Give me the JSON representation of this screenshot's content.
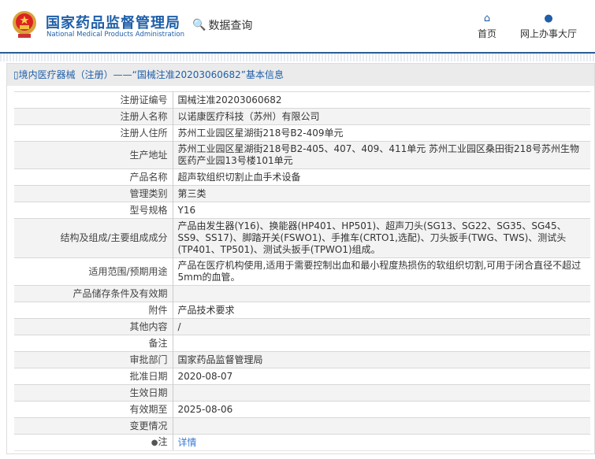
{
  "header": {
    "brand_cn": "国家药品监督管理局",
    "brand_en": "National Medical Products Administration",
    "query_label": "数据查询",
    "nav": [
      {
        "label": "首页",
        "icon": "home-icon"
      },
      {
        "label": "网上办事大厅",
        "icon": "user-icon"
      }
    ]
  },
  "breadcrumb": "境内医疗器械（注册）——“国械注准20203060682”基本信息",
  "rows": [
    {
      "label": "注册证编号",
      "value": "国械注准20203060682"
    },
    {
      "label": "注册人名称",
      "value": "以诺康医疗科技（苏州）有限公司"
    },
    {
      "label": "注册人住所",
      "value": "苏州工业园区星湖街218号B2-409单元"
    },
    {
      "label": "生产地址",
      "value": "苏州工业园区星湖街218号B2-405、407、409、411单元 苏州工业园区桑田街218号苏州生物医药产业园13号楼101单元"
    },
    {
      "label": "产品名称",
      "value": "超声软组织切割止血手术设备"
    },
    {
      "label": "管理类别",
      "value": "第三类"
    },
    {
      "label": "型号规格",
      "value": "Y16"
    },
    {
      "label": "结构及组成/主要组成成分",
      "value": "产品由发生器(Y16)、换能器(HP401、HP501)、超声刀头(SG13、SG22、SG35、SG45、SS9、SS17)、脚踏开关(FSWO1)、手推车(CRTO1,选配)、刀头扳手(TWG、TWS)、测试头(TP401、TP501)、测试头扳手(TPWO1)组成。"
    },
    {
      "label": "适用范围/预期用途",
      "value": "产品在医疗机构使用,适用于需要控制出血和最小程度热损伤的软组织切割,可用于闭合直径不超过5mm的血管。"
    },
    {
      "label": "产品储存条件及有效期",
      "value": ""
    },
    {
      "label": "附件",
      "value": "产品技术要求"
    },
    {
      "label": "其他内容",
      "value": "/"
    },
    {
      "label": "备注",
      "value": ""
    },
    {
      "label": "审批部门",
      "value": "国家药品监督管理局"
    },
    {
      "label": "批准日期",
      "value": "2020-08-07"
    },
    {
      "label": "生效日期",
      "value": ""
    },
    {
      "label": "有效期至",
      "value": "2025-08-06"
    },
    {
      "label": "变更情况",
      "value": ""
    },
    {
      "label": "注",
      "value": "详情",
      "link": true
    }
  ]
}
